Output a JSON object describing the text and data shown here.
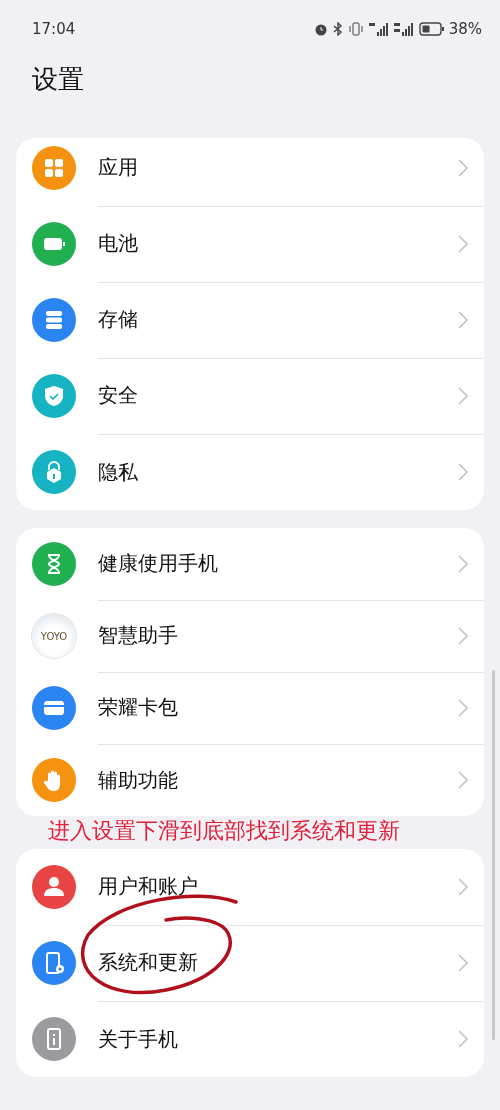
{
  "status_bar": {
    "time": "17:04",
    "battery": "38%"
  },
  "title": "设置",
  "groups": [
    {
      "items": [
        {
          "label": "应用",
          "kind": "icon",
          "color": "#f5920f"
        },
        {
          "label": "电池",
          "kind": "icon",
          "color": "#21b04f"
        },
        {
          "label": "存储",
          "kind": "icon",
          "color": "#2a84f2"
        },
        {
          "label": "安全",
          "kind": "icon",
          "color": "#16b3c2"
        },
        {
          "label": "隐私",
          "kind": "icon",
          "color": "#16b3c2"
        }
      ]
    },
    {
      "items": [
        {
          "label": "健康使用手机",
          "kind": "icon",
          "color": "#21b04f"
        },
        {
          "label": "智慧助手",
          "kind": "logo",
          "logo_text": "YOYO"
        },
        {
          "label": "荣耀卡包",
          "kind": "icon",
          "color": "#2a84f2"
        },
        {
          "label": "辅助功能",
          "kind": "icon",
          "color": "#f5920f"
        }
      ]
    },
    {
      "items": [
        {
          "label": "用户和账户",
          "kind": "icon",
          "color": "#e84444"
        },
        {
          "label": "系统和更新",
          "kind": "icon",
          "color": "#2a84f2"
        },
        {
          "label": "关于手机",
          "kind": "icon",
          "color": "#9a9a9f"
        }
      ]
    }
  ],
  "annotation": {
    "text": "进入设置下滑到底部找到系统和更新"
  }
}
